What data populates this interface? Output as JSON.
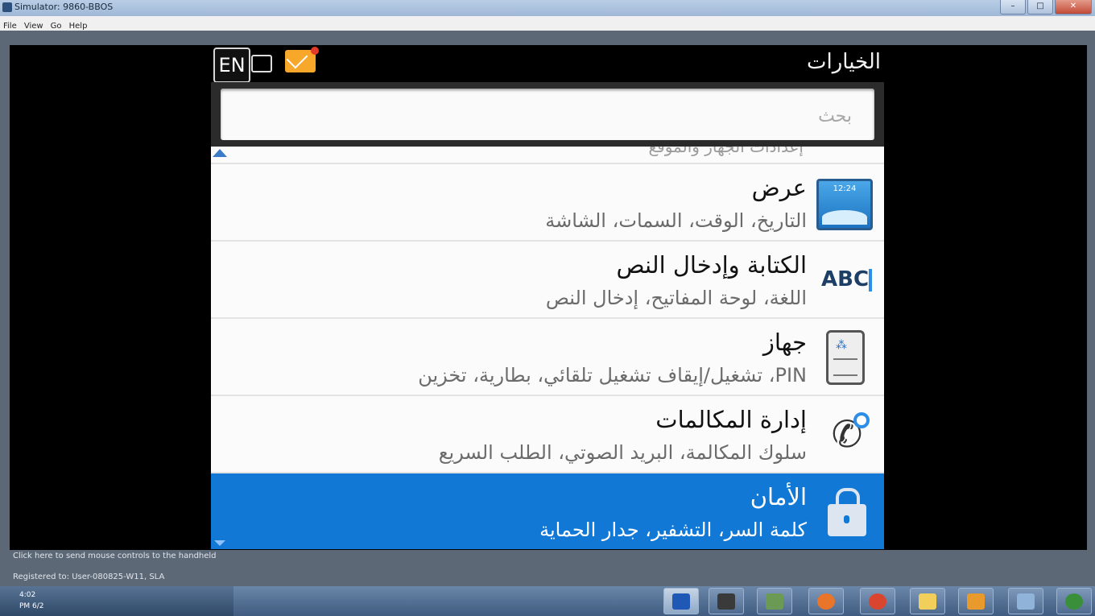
{
  "window": {
    "title": "Simulator: 9860-BBOS",
    "controls": {
      "minimize": "–",
      "maximize": "□",
      "close": "✕"
    }
  },
  "menu": [
    "File",
    "View",
    "Go",
    "Help"
  ],
  "phone": {
    "header": {
      "title": "الخيارات",
      "lang": "EN",
      "icons": [
        "battery-icon",
        "mail-icon"
      ]
    },
    "search": {
      "placeholder": "بحث"
    },
    "partial_row_text": "إعدادات الجهاز والموقع",
    "items": [
      {
        "title": "عرض",
        "subtitle": "التاريخ، الوقت، السمات، الشاشة",
        "icon": "display-icon",
        "icon_text": "12:24"
      },
      {
        "title": "الكتابة وإدخال النص",
        "subtitle": "اللغة، لوحة المفاتيح، إدخال النص",
        "icon": "abc-icon",
        "icon_text": "ABC"
      },
      {
        "title": "جهاز",
        "subtitle": "PIN، تشغيل/إيقاف تشغيل تلقائي، بطارية، تخزين",
        "icon": "device-icon",
        "icon_text": "⁂"
      },
      {
        "title": "إدارة المكالمات",
        "subtitle": "سلوك المكالمة، البريد الصوتي، الطلب السريع",
        "icon": "call-icon",
        "icon_text": "✆"
      },
      {
        "title": "الأمان",
        "subtitle": "كلمة السر، التشفير، جدار الحماية",
        "icon": "lock-icon",
        "selected": true
      }
    ]
  },
  "footer": {
    "line1": "Click here to send mouse controls to the handheld",
    "line2": "Registered to: User-080825-W11, SLA"
  },
  "taskbar": {
    "clock": "4:02",
    "date": "PM  6/2",
    "apps": [
      "simulator-icon",
      "media-icon",
      "network-icon",
      "firefox-icon",
      "chrome-icon",
      "folder-icon",
      "player-icon",
      "computer-icon",
      "windows-icon"
    ],
    "colors": {
      "accent": "#1278d6",
      "mail": "#f7a72a"
    }
  }
}
